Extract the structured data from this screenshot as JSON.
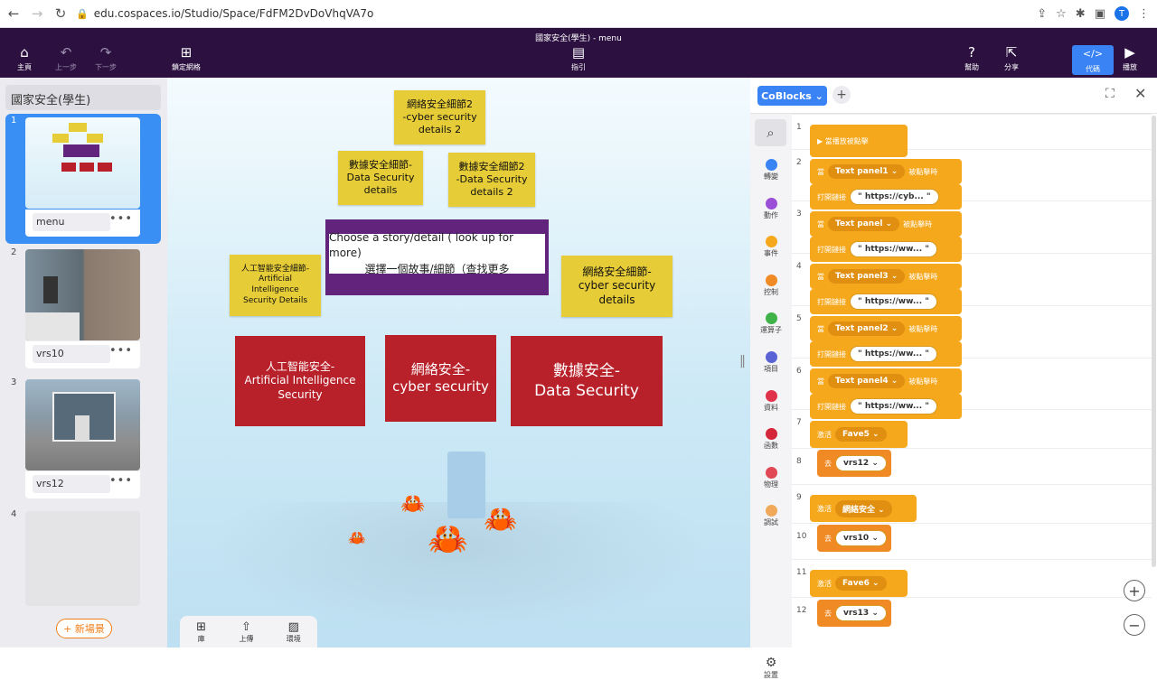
{
  "browser": {
    "url": "edu.cospaces.io/Studio/Space/FdFM2DvDoVhqVA7o",
    "avatar": "T"
  },
  "app": {
    "title": "國家安全(學生) - menu",
    "toolbar": {
      "home": "主頁",
      "undo": "上一步",
      "redo": "下一步",
      "grid": "鎖定網格",
      "guide": "指引",
      "help": "幫助",
      "share": "分享",
      "code": "代碼",
      "play": "播放"
    }
  },
  "sidebar": {
    "project_title": "國家安全(學生)",
    "scenes": [
      {
        "num": "1",
        "name": "menu"
      },
      {
        "num": "2",
        "name": "vrs10"
      },
      {
        "num": "3",
        "name": "vrs12"
      },
      {
        "num": "4",
        "name": ""
      }
    ],
    "new_scene": "+ 新場景"
  },
  "viewport": {
    "yellow_panels": [
      {
        "text": "網絡安全細節2\n-cyber security\ndetails 2"
      },
      {
        "text": "數據安全細節-\nData Security\ndetails"
      },
      {
        "text": "數據安全細節2\n-Data Security\ndetails 2"
      },
      {
        "text": "人工智能安全細節-\nArtificial\nIntelligence\nSecurity Details"
      },
      {
        "text": "網絡安全細節-\ncyber security\ndetails"
      }
    ],
    "purple_line1": "Choose a story/detail ( look up for more)",
    "purple_line2": "選擇一個故事/細節（查找更多",
    "red_panels": [
      {
        "text": "人工智能安全-\nArtificial Intelligence\nSecurity"
      },
      {
        "text": "網絡安全-\ncyber security"
      },
      {
        "text": "數據安全-\nData Security"
      }
    ],
    "bottom_tools": {
      "library": "庫",
      "upload": "上傳",
      "environment": "環境"
    }
  },
  "code": {
    "tab": "CoBlocks",
    "categories": [
      {
        "label": "轉變",
        "color": "#3a83f5"
      },
      {
        "label": "動作",
        "color": "#9b4fd6"
      },
      {
        "label": "事件",
        "color": "#f5a81c"
      },
      {
        "label": "控制",
        "color": "#f08a24"
      },
      {
        "label": "運算子",
        "color": "#3fb24a"
      },
      {
        "label": "項目",
        "color": "#5b62d6"
      },
      {
        "label": "資料",
        "color": "#e0334b"
      },
      {
        "label": "函數",
        "color": "#d4273a"
      },
      {
        "label": "物理",
        "color": "#e04855"
      },
      {
        "label": "調試",
        "color": "#f0a85a"
      }
    ],
    "settings": "設置",
    "lines": [
      "1",
      "2",
      "3",
      "4",
      "5",
      "6",
      "7",
      "8",
      "9",
      "10",
      "11",
      "12"
    ],
    "blocks": {
      "event_start": "▶ 當播放被點擊",
      "when": "當",
      "clicked": "被點擊時",
      "open_link": "打開鏈接",
      "panels": [
        "Text panel1",
        "Text panel",
        "Text panel3",
        "Text panel2",
        "Text panel4"
      ],
      "links": [
        "\" https://cyb... \"",
        "\" https://ww... \"",
        "\" https://ww... \"",
        "\" https://ww... \"",
        "\" https://ww... \""
      ],
      "activate": "激活",
      "goto": "去",
      "activate_targets": [
        "Fave5",
        "網絡安全",
        "Fave6"
      ],
      "goto_targets": [
        "vrs12",
        "vrs10",
        "vrs13"
      ]
    }
  }
}
